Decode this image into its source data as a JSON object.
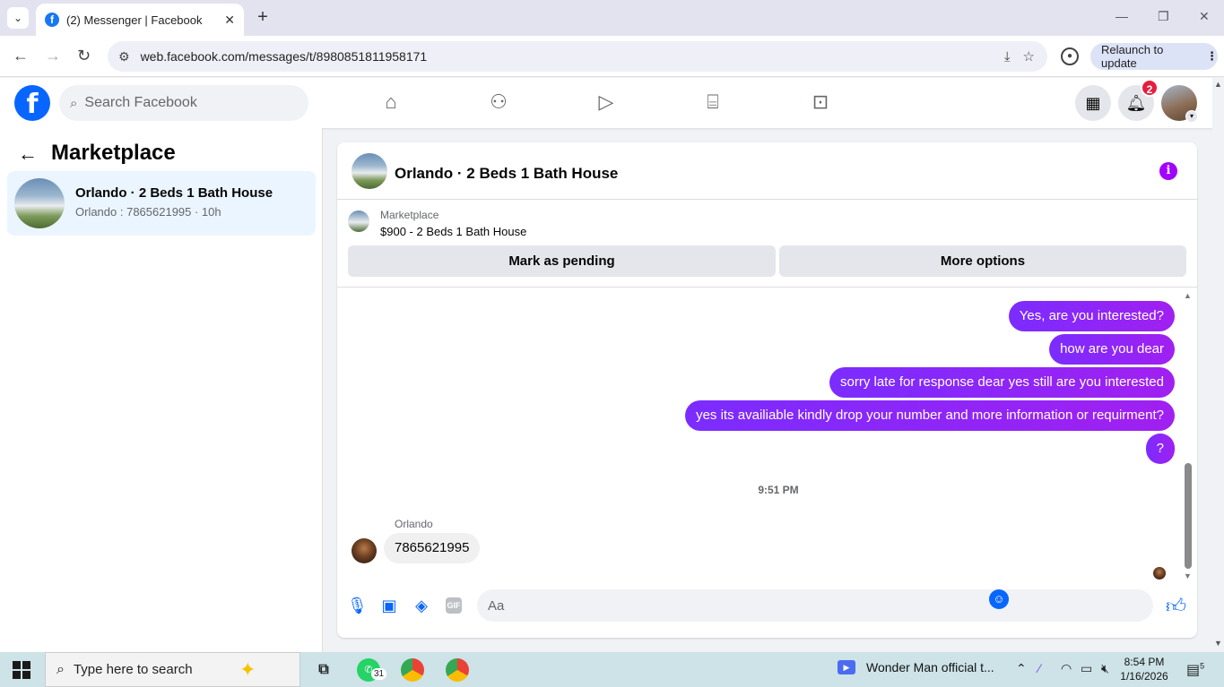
{
  "browser": {
    "tab_title": "(2) Messenger | Facebook",
    "favicon_letter": "f",
    "url": "web.facebook.com/messages/t/8980851811958171",
    "relaunch_label": "Relaunch to update",
    "icons": [
      "chevron-down-icon",
      "close-icon",
      "plus-icon",
      "back-arrow-icon",
      "forward-arrow-icon",
      "reload-icon",
      "site-settings-icon",
      "install-icon",
      "star-icon",
      "profile-icon",
      "menu-dots-icon"
    ]
  },
  "fb_header": {
    "logo_letter": "f",
    "search_placeholder": "Search Facebook",
    "notification_count": "2",
    "accent_color": "#0866ff"
  },
  "left_panel": {
    "title": "Marketplace",
    "conversation": {
      "name": "Orlando · 2 Beds 1 Bath House",
      "subtitle": "Orlando : 7865621995 · 10h"
    }
  },
  "chat": {
    "title": "Orlando · 2 Beds 1 Bath House",
    "listing": {
      "label": "Marketplace",
      "price_title": "$900 - 2 Beds 1 Bath House",
      "mark_pending_label": "Mark as pending",
      "more_options_label": "More options"
    },
    "outgoing": [
      "Yes, are you interested?",
      "how are you dear",
      "sorry late for response dear yes still are you interested",
      "yes its availiable  kindly  drop your number and more information or requirment?",
      "?"
    ],
    "timestamp": "9:51 PM",
    "sender_name": "Orlando",
    "incoming_message": "7865621995",
    "composer_placeholder": "Aa",
    "gif_label": "GIF",
    "bubble_color": "#8a2be2"
  },
  "taskbar": {
    "search_placeholder": "Type here to search",
    "whatsapp_count": "31",
    "media_title": "Wonder Man official t...",
    "time": "8:54 PM",
    "date": "1/16/2026",
    "notification_count": "5"
  }
}
